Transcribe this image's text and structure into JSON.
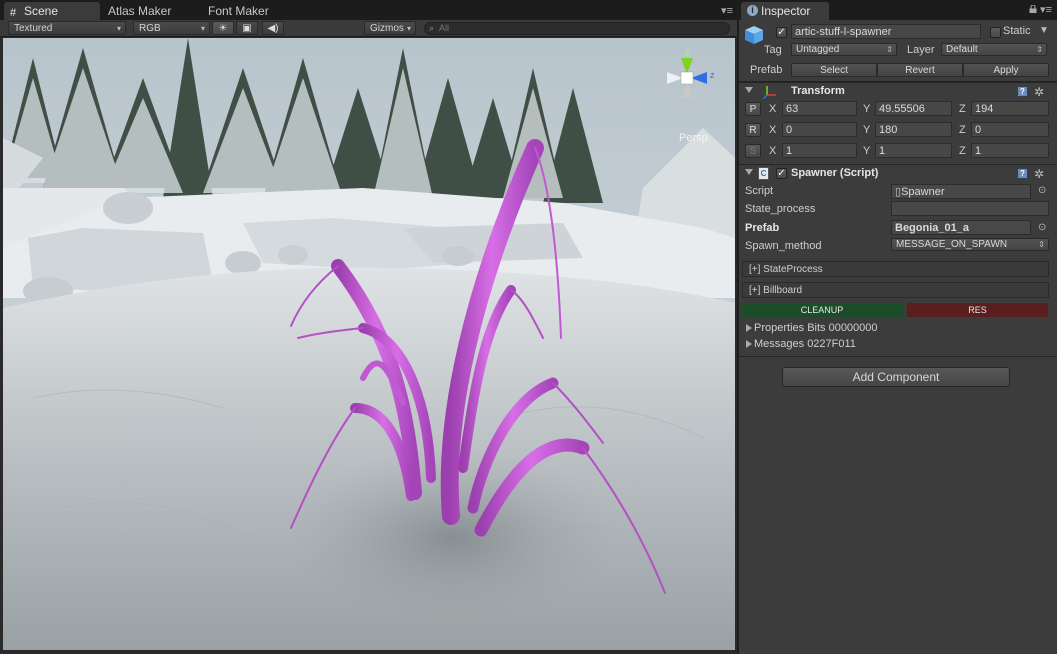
{
  "scene_tabs": {
    "scene": "Scene",
    "atlas_maker": "Atlas Maker",
    "font_maker": "Font Maker"
  },
  "scene_toolbar": {
    "render_mode": "Textured",
    "color_mode": "RGB",
    "gizmos": "Gizmos",
    "search_placeholder": "All"
  },
  "viewport": {
    "projection_label": "Persp",
    "gizmo_y": "y",
    "gizmo_z": "z"
  },
  "inspector": {
    "tab_label": "Inspector",
    "object_name": "artic-stuff-l-spawner",
    "active": true,
    "static_label": "Static",
    "tag_label": "Tag",
    "tag_value": "Untagged",
    "layer_label": "Layer",
    "layer_value": "Default",
    "prefab_label": "Prefab",
    "prefab_select": "Select",
    "prefab_revert": "Revert",
    "prefab_apply": "Apply"
  },
  "transform": {
    "title": "Transform",
    "p_btn": "P",
    "r_btn": "R",
    "s_btn": "S",
    "axis_x": "X",
    "axis_y": "Y",
    "axis_z": "Z",
    "position": {
      "x": "63",
      "y": "49.55506",
      "z": "194"
    },
    "rotation": {
      "x": "0",
      "y": "180",
      "z": "0"
    },
    "scale": {
      "x": "1",
      "y": "1",
      "z": "1"
    }
  },
  "spawner": {
    "title": "Spawner (Script)",
    "enabled": true,
    "script_label": "Script",
    "script_value": "Spawner",
    "state_process_label": "State_process",
    "state_process_value": "",
    "prefab_label": "Prefab",
    "prefab_value": "Begonia_01_a",
    "spawn_method_label": "Spawn_method",
    "spawn_method_value": "MESSAGE_ON_SPAWN",
    "state_process_section": "[+] StateProcess",
    "billboard_section": "[+] Billboard",
    "cleanup_button": "CLEANUP",
    "res_button": "RES",
    "properties_bits": "Properties Bits  00000000",
    "messages": "Messages  0227F011"
  },
  "add_component": "Add Component"
}
